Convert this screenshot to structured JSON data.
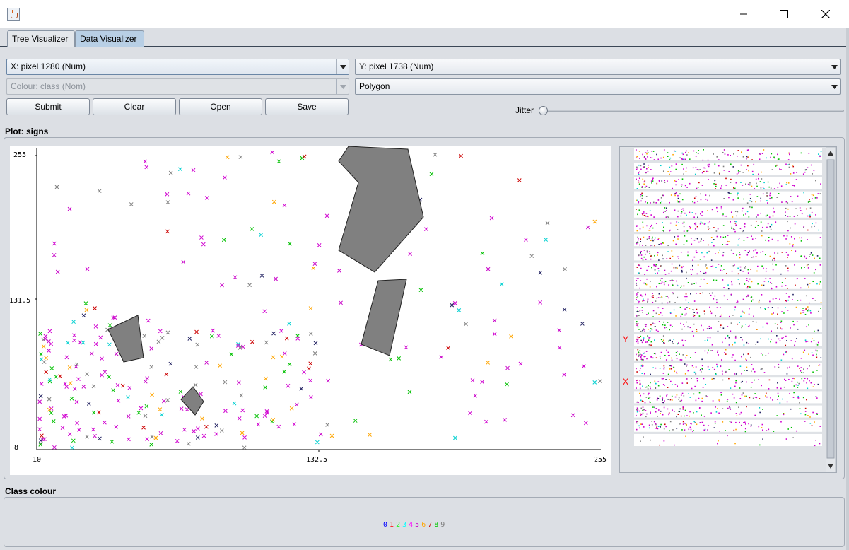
{
  "window": {
    "title": "",
    "controls": {
      "minimize": "minimize-icon",
      "maximize": "maximize-icon",
      "close": "close-icon"
    }
  },
  "tabs": [
    {
      "label": "Tree Visualizer",
      "active": false
    },
    {
      "label": "Data Visualizer",
      "active": true
    }
  ],
  "controls": {
    "x_select": "X: pixel 1280 (Num)",
    "y_select": "Y: pixel 1738 (Num)",
    "colour_select": "Colour: class (Nom)",
    "shape_select": "Polygon",
    "buttons": {
      "submit": "Submit",
      "clear": "Clear",
      "open": "Open",
      "save": "Save"
    },
    "jitter_label": "Jitter",
    "jitter_value": 0
  },
  "plot": {
    "section_label": "Plot: signs",
    "x_axis": {
      "min": "10",
      "mid": "132.5",
      "max": "255"
    },
    "y_axis": {
      "min": "8",
      "mid": "131.5",
      "max": "255"
    }
  },
  "matrix": {
    "y_marker": "Y",
    "x_marker": "X"
  },
  "class_colour": {
    "label": "Class colour",
    "classes": [
      {
        "label": "0",
        "color": "#0000ff"
      },
      {
        "label": "1",
        "color": "#ff0000"
      },
      {
        "label": "2",
        "color": "#00ff00"
      },
      {
        "label": "3",
        "color": "#00ffff"
      },
      {
        "label": "4",
        "color": "#ff00ff"
      },
      {
        "label": "5",
        "color": "#c800c8"
      },
      {
        "label": "6",
        "color": "#ffa500"
      },
      {
        "label": "7",
        "color": "#c80000"
      },
      {
        "label": "8",
        "color": "#00c800"
      },
      {
        "label": "9",
        "color": "#808080"
      }
    ]
  }
}
